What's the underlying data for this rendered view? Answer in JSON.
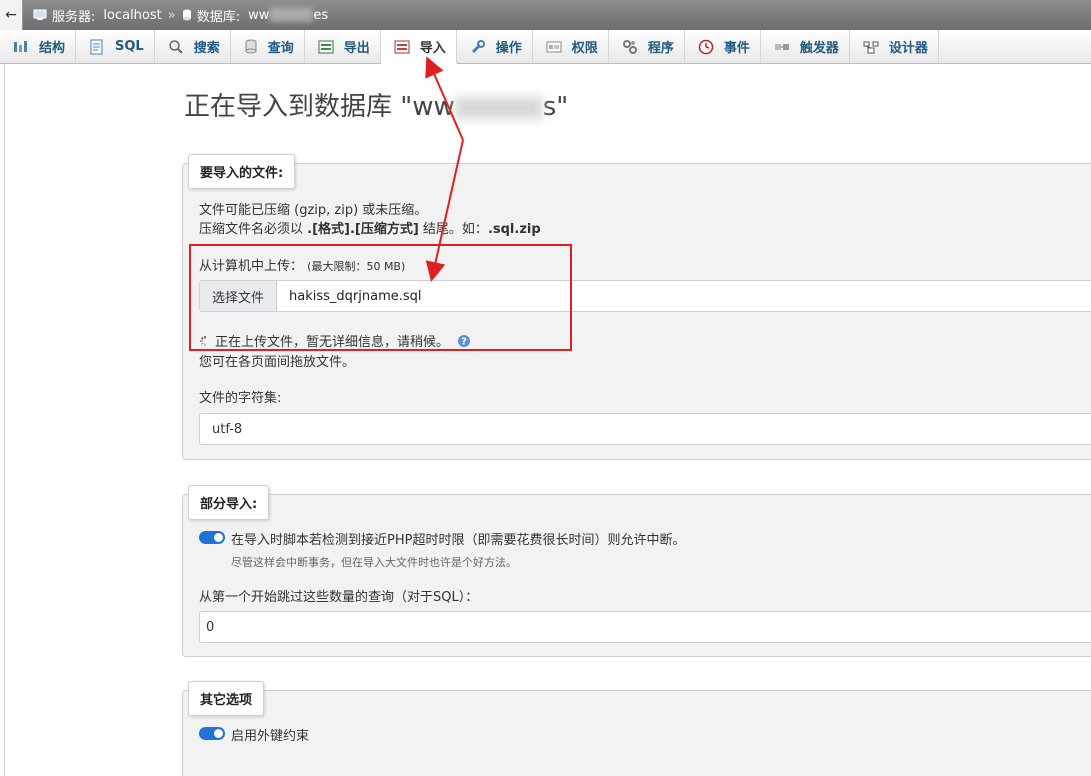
{
  "breadcrumb": {
    "back": "←",
    "server_label": "服务器:",
    "server_value": "localhost",
    "separator": "»",
    "db_label": "数据库:",
    "db_prefix": "ww",
    "db_suffix": "es"
  },
  "tabs": [
    {
      "label": "结构",
      "icon": "structure-icon"
    },
    {
      "label": "SQL",
      "icon": "sql-icon"
    },
    {
      "label": "搜索",
      "icon": "search-icon"
    },
    {
      "label": "查询",
      "icon": "query-icon"
    },
    {
      "label": "导出",
      "icon": "export-icon"
    },
    {
      "label": "导入",
      "icon": "import-icon",
      "active": true
    },
    {
      "label": "操作",
      "icon": "wrench-icon"
    },
    {
      "label": "权限",
      "icon": "privileges-icon"
    },
    {
      "label": "程序",
      "icon": "routines-icon"
    },
    {
      "label": "事件",
      "icon": "clock-icon"
    },
    {
      "label": "触发器",
      "icon": "triggers-icon"
    },
    {
      "label": "设计器",
      "icon": "designer-icon"
    }
  ],
  "page_title_prefix": "正在导入到数据库 \"ww",
  "page_title_suffix": "s\"",
  "file_section": {
    "legend": "要导入的文件:",
    "note1": "文件可能已压缩 (gzip, zip) 或未压缩。",
    "note2_a": "压缩文件名必须以 ",
    "note2_b": ".[格式].[压缩方式]",
    "note2_c": " 结尾。如：",
    "note2_d": ".sql.zip",
    "upload_label": "从计算机中上传：",
    "upload_limit": "(最大限制：50 MB)",
    "choose_button": "选择文件",
    "file_name": "hakiss_dqrjname.sql",
    "uploading_status": "正在上传文件，暂无详细信息，请稍候。",
    "drag_note": "您可在各页面间拖放文件。",
    "charset_label": "文件的字符集:",
    "charset_value": "utf-8"
  },
  "partial_section": {
    "legend": "部分导入:",
    "allow_interrupt": "在导入时脚本若检测到接近PHP超时时限（即需要花费很长时间）则允许中断。",
    "allow_interrupt_hint": "尽管这样会中断事务，但在导入大文件时也许是个好方法。",
    "skip_label": "从第一个开始跳过这些数量的查询（对于SQL）：",
    "skip_value": "0"
  },
  "other_section": {
    "legend": "其它选项",
    "fk_checks": "启用外键约束"
  },
  "colors": {
    "tab_text": "#235a81",
    "toggle": "#1e73d8",
    "annotation": "#e02020"
  }
}
